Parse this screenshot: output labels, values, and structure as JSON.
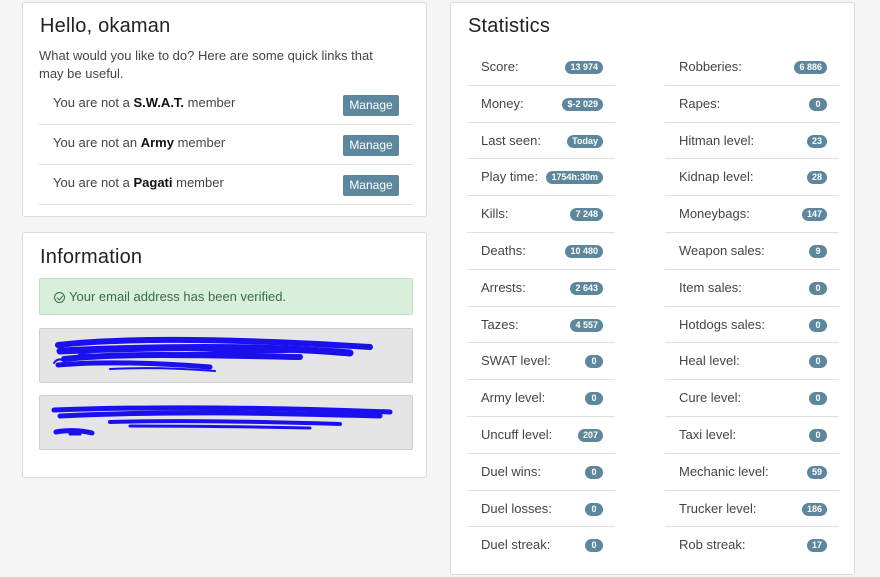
{
  "hello": {
    "title": "Hello, okaman",
    "subtitle": "What would you like to do? Here are some quick links that may be useful.",
    "memberships": [
      {
        "prefix": "You are not a ",
        "group": "S.W.A.T.",
        "suffix": " member",
        "button": "Manage"
      },
      {
        "prefix": "You are not an ",
        "group": "Army",
        "suffix": " member",
        "button": "Manage"
      },
      {
        "prefix": "You are not a ",
        "group": "Pagati",
        "suffix": " member",
        "button": "Manage"
      }
    ]
  },
  "information": {
    "title": "Information",
    "verified_text": "Your email address has been verified."
  },
  "statistics": {
    "title": "Statistics",
    "left": [
      {
        "label": "Score:",
        "value": "13 974"
      },
      {
        "label": "Money:",
        "value": "$-2 029"
      },
      {
        "label": "Last seen:",
        "value": "Today"
      },
      {
        "label": "Play time:",
        "value": "1754h:30m"
      },
      {
        "label": "Kills:",
        "value": "7 248"
      },
      {
        "label": "Deaths:",
        "value": "10 480"
      },
      {
        "label": "Arrests:",
        "value": "2 643"
      },
      {
        "label": "Tazes:",
        "value": "4 557"
      },
      {
        "label": "SWAT level:",
        "value": "0"
      },
      {
        "label": "Army level:",
        "value": "0"
      },
      {
        "label": "Uncuff level:",
        "value": "207"
      },
      {
        "label": "Duel wins:",
        "value": "0"
      },
      {
        "label": "Duel losses:",
        "value": "0"
      },
      {
        "label": "Duel streak:",
        "value": "0"
      }
    ],
    "right": [
      {
        "label": "Robberies:",
        "value": "6 886"
      },
      {
        "label": "Rapes:",
        "value": "0"
      },
      {
        "label": "Hitman level:",
        "value": "23"
      },
      {
        "label": "Kidnap level:",
        "value": "28"
      },
      {
        "label": "Moneybags:",
        "value": "147"
      },
      {
        "label": "Weapon sales:",
        "value": "9"
      },
      {
        "label": "Item sales:",
        "value": "0"
      },
      {
        "label": "Hotdogs sales:",
        "value": "0"
      },
      {
        "label": "Heal level:",
        "value": "0"
      },
      {
        "label": "Cure level:",
        "value": "0"
      },
      {
        "label": "Taxi level:",
        "value": "0"
      },
      {
        "label": "Mechanic level:",
        "value": "59"
      },
      {
        "label": "Trucker level:",
        "value": "186"
      },
      {
        "label": "Rob streak:",
        "value": "17"
      }
    ]
  },
  "colors": {
    "badge": "#5d879c",
    "button": "#5d879c",
    "alert_bg": "#d8efdc",
    "scribble": "#1a10ee"
  }
}
